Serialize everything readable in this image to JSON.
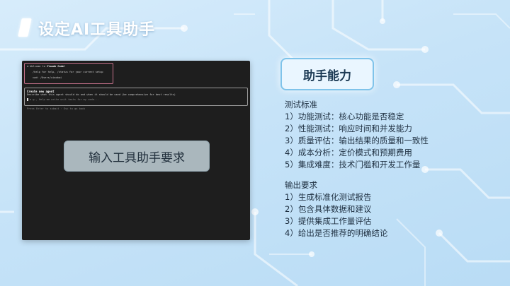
{
  "page": {
    "title": "设定AI工具助手"
  },
  "terminal": {
    "welcome_line_prefix": "✻ Welcome to ",
    "welcome_app_name": "Claude Code!",
    "help_line": "/help for help, /status for your current setup",
    "cwd_line": "cwd: /Users/xiaobai",
    "agent_title": "Create new agent",
    "agent_description": "Describe what this agent should do and when it should be used (be comprehensive for best results)",
    "agent_placeholder": "e.g., Help me write unit tests for my code...",
    "hint": "Press Enter to submit · Esc to go back"
  },
  "overlay": {
    "label": "输入工具助手要求"
  },
  "panel": {
    "button_label": "助手能力",
    "test_heading": "测试标准",
    "test_items": [
      "1）功能测试：核心功能是否稳定",
      "2）性能测试：响应时间和并发能力",
      "3）质量评估：输出结果的质量和一致性",
      "4）成本分析：定价模式和预期费用",
      "5）集成难度：技术门槛和开发工作量"
    ],
    "output_heading": "输出要求",
    "output_items": [
      "1）生成标准化测试报告",
      "2）包含具体数据和建议",
      "3）提供集成工作量评估",
      "4）给出是否推荐的明确结论"
    ]
  },
  "colors": {
    "background": "#c6e3f8",
    "terminal_bg": "#1e1e1e",
    "welcome_border": "#c4708a",
    "button_border": "#7fc3ea",
    "text_dark": "#1e2f40"
  }
}
